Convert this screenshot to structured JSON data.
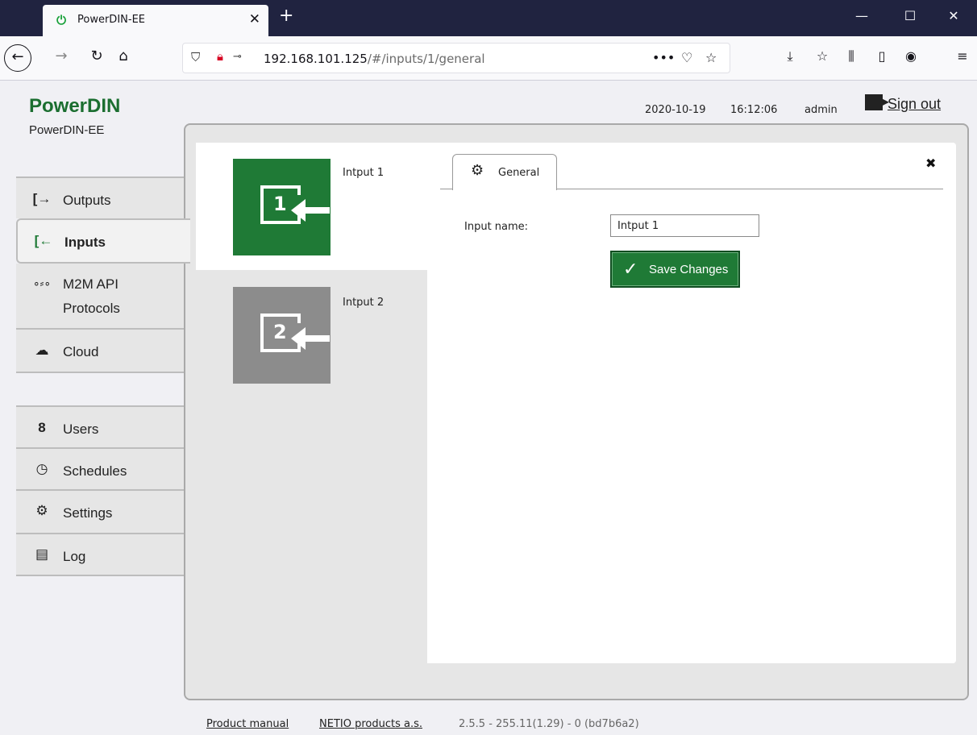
{
  "browser": {
    "tab_title": "PowerDIN-EE",
    "url_host": "192.168.101.125",
    "url_path": "/#/inputs/1/general",
    "url_menu": "•••"
  },
  "header": {
    "brand": "PowerDIN",
    "device": "PowerDIN-EE",
    "date": "2020-10-19",
    "time": "16:12:06",
    "user": "admin",
    "signout": "Sign out"
  },
  "sidebar": {
    "items": [
      {
        "label": "Outputs",
        "icon": "outputs-icon"
      },
      {
        "label": "Inputs",
        "icon": "inputs-icon"
      },
      {
        "label": "M2M API",
        "label2": "Protocols",
        "icon": "m2m-icon"
      },
      {
        "label": "Cloud",
        "icon": "cloud-icon"
      },
      {
        "label": "Users",
        "icon": "users-icon"
      },
      {
        "label": "Schedules",
        "icon": "clock-icon"
      },
      {
        "label": "Settings",
        "icon": "gear-icon"
      },
      {
        "label": "Log",
        "icon": "log-icon"
      }
    ]
  },
  "inputs": [
    {
      "number": "1",
      "label": "Intput 1",
      "color": "#1f7a36"
    },
    {
      "number": "2",
      "label": "Intput 2",
      "color": "#8c8c8c"
    }
  ],
  "detail": {
    "tab": "General",
    "field_label": "Input name:",
    "field_value": "Intput 1",
    "save_label": "Save Changes"
  },
  "footer": {
    "manual": "Product manual",
    "company": "NETIO products a.s.",
    "version": "2.5.5 - 255.11(1.29) - 0 (bd7b6a2)"
  },
  "colors": {
    "brand": "#1b6e30",
    "accent": "#1f7a36",
    "inactive_tile": "#8c8c8c"
  }
}
